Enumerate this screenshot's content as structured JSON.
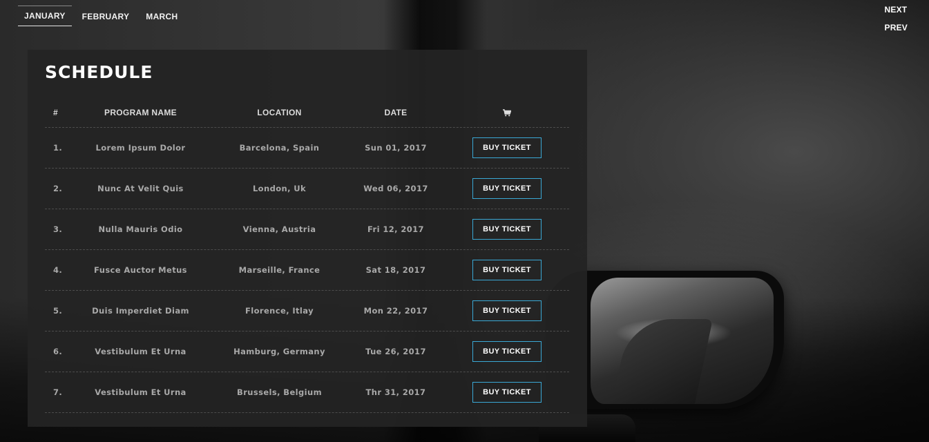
{
  "months": [
    {
      "label": "JANUARY",
      "active": true
    },
    {
      "label": "FEBRUARY",
      "active": false
    },
    {
      "label": "MARCH",
      "active": false
    }
  ],
  "pager": {
    "next": "NEXT",
    "prev": "PREV"
  },
  "schedule": {
    "title": "SCHEDULE",
    "headers": {
      "num": "#",
      "program": "PROGRAM NAME",
      "location": "LOCATION",
      "date": "DATE",
      "cart_icon": "cart-icon"
    },
    "button_label": "BUY TICKET",
    "accent_color": "#3aa9d6",
    "rows": [
      {
        "num": "1.",
        "program": "Lorem Ipsum Dolor",
        "location": "Barcelona, Spain",
        "date": "Sun 01, 2017"
      },
      {
        "num": "2.",
        "program": "Nunc At Velit Quis",
        "location": "London, Uk",
        "date": "Wed 06, 2017"
      },
      {
        "num": "3.",
        "program": "Nulla Mauris Odio",
        "location": "Vienna, Austria",
        "date": "Fri 12, 2017"
      },
      {
        "num": "4.",
        "program": "Fusce Auctor Metus",
        "location": "Marseille, France",
        "date": "Sat 18, 2017"
      },
      {
        "num": "5.",
        "program": "Duis Imperdiet Diam",
        "location": "Florence, Itlay",
        "date": "Mon 22, 2017"
      },
      {
        "num": "6.",
        "program": "Vestibulum Et Urna",
        "location": "Hamburg, Germany",
        "date": "Tue 26, 2017"
      },
      {
        "num": "7.",
        "program": "Vestibulum Et Urna",
        "location": "Brussels, Belgium",
        "date": "Thr 31, 2017"
      }
    ]
  }
}
